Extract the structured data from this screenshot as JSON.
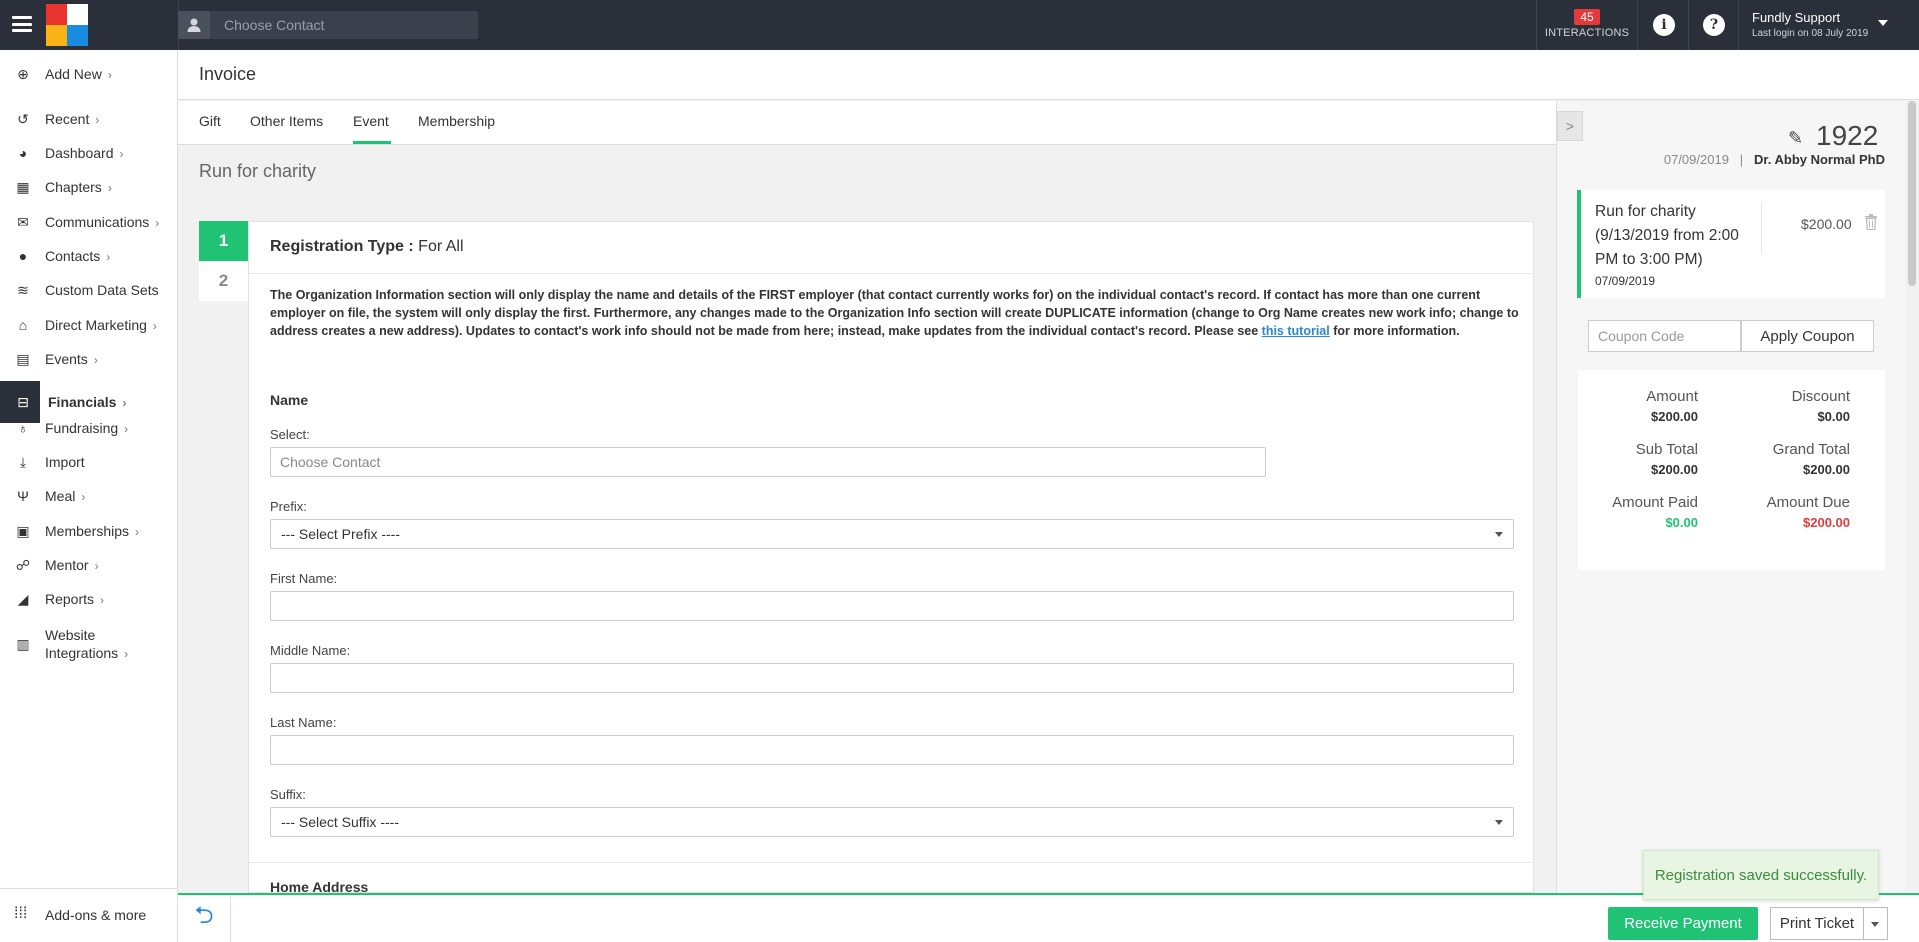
{
  "topbar": {
    "search_placeholder": "Choose Contact",
    "interactions_count": "45",
    "interactions_label": "INTERACTIONS",
    "user_name": "Fundly Support",
    "last_login": "Last login on 08 July 2019"
  },
  "sidebar": {
    "items": [
      {
        "label": "Add New",
        "icon": "plus-circle-icon",
        "glyph": "⊕",
        "chevron": true
      },
      {
        "label": "Recent",
        "icon": "history-icon",
        "glyph": "↺",
        "chevron": true
      },
      {
        "label": "Dashboard",
        "icon": "dashboard-icon",
        "glyph": "◕",
        "chevron": true
      },
      {
        "label": "Chapters",
        "icon": "grid-icon",
        "glyph": "▦",
        "chevron": true
      },
      {
        "label": "Communications",
        "icon": "envelope-icon",
        "glyph": "✉",
        "chevron": true
      },
      {
        "label": "Contacts",
        "icon": "user-icon",
        "glyph": "●",
        "chevron": true
      },
      {
        "label": "Custom Data Sets",
        "icon": "database-icon",
        "glyph": "≋",
        "chevron": false
      },
      {
        "label": "Direct Marketing",
        "icon": "bank-icon",
        "glyph": "⌂",
        "chevron": true
      },
      {
        "label": "Events",
        "icon": "calendar-icon",
        "glyph": "▤",
        "chevron": true
      },
      {
        "label": "Financials",
        "icon": "money-icon",
        "glyph": "⊟",
        "chevron": true
      },
      {
        "label": "Fundraising",
        "icon": "moneybag-icon",
        "glyph": "♁",
        "chevron": true
      },
      {
        "label": "Import",
        "icon": "download-icon",
        "glyph": "⤓",
        "chevron": false
      },
      {
        "label": "Meal",
        "icon": "utensils-icon",
        "glyph": "Ψ",
        "chevron": true
      },
      {
        "label": "Memberships",
        "icon": "id-card-icon",
        "glyph": "▣",
        "chevron": true
      },
      {
        "label": "Mentor",
        "icon": "people-icon",
        "glyph": "☍",
        "chevron": true
      },
      {
        "label": "Reports",
        "icon": "chart-icon",
        "glyph": "◢",
        "chevron": true
      },
      {
        "label": "Website Integrations",
        "icon": "browser-icon",
        "glyph": "▥",
        "chevron": true
      }
    ],
    "bottom_label": "Add-ons & more"
  },
  "page": {
    "title": "Invoice",
    "tabs": [
      "Gift",
      "Other Items",
      "Event",
      "Membership"
    ],
    "active_tab": "Event",
    "event_title": "Run for charity"
  },
  "form": {
    "steps": [
      "1",
      "2"
    ],
    "reg_type_label": "Registration Type :",
    "reg_type_value": " For All",
    "notice_pre": "The Organization Information section will only display the name and details of the FIRST employer (that contact currently works for) on the individual contact's record. If contact has more than one current employer on file, the system will only display the first. Furthermore, any changes made to the Organization Info section will create DUPLICATE information (change to Org Name creates new work info; change to address creates a new address). Updates to contact's work info should not be made from here; instead, make updates from the individual contact's record. Please see ",
    "notice_link": "this tutorial",
    "notice_post": " for more information.",
    "name_section": "Name",
    "select_label": "Select:",
    "select_placeholder": "Choose Contact",
    "prefix_label": "Prefix:",
    "prefix_value": "--- Select Prefix ----",
    "first_label": "First Name:",
    "middle_label": "Middle Name:",
    "last_label": "Last Name:",
    "suffix_label": "Suffix:",
    "suffix_value": "--- Select Suffix ----",
    "address_section": "Home Address"
  },
  "invoice": {
    "number": "1922",
    "date": "07/09/2019",
    "separator": "|",
    "contact": "Dr. Abby Normal PhD",
    "line_desc": "Run for charity (9/13/2019 from 2:00 PM to 3:00 PM)",
    "line_date": "07/09/2019",
    "line_amount": "$200.00",
    "coupon_placeholder": "Coupon Code",
    "apply_coupon": "Apply Coupon",
    "totals": {
      "amount_label": "Amount",
      "amount": "$200.00",
      "discount_label": "Discount",
      "discount": "$0.00",
      "subtotal_label": "Sub Total",
      "subtotal": "$200.00",
      "grandtotal_label": "Grand Total",
      "grandtotal": "$200.00",
      "paid_label": "Amount Paid",
      "paid": "$0.00",
      "due_label": "Amount Due",
      "due": "$200.00"
    },
    "colors": {
      "paid": "#20c374",
      "due": "#e33b3b"
    }
  },
  "footer": {
    "receive_payment": "Receive Payment",
    "print_ticket": "Print Ticket"
  },
  "toast": "Registration saved successfully."
}
